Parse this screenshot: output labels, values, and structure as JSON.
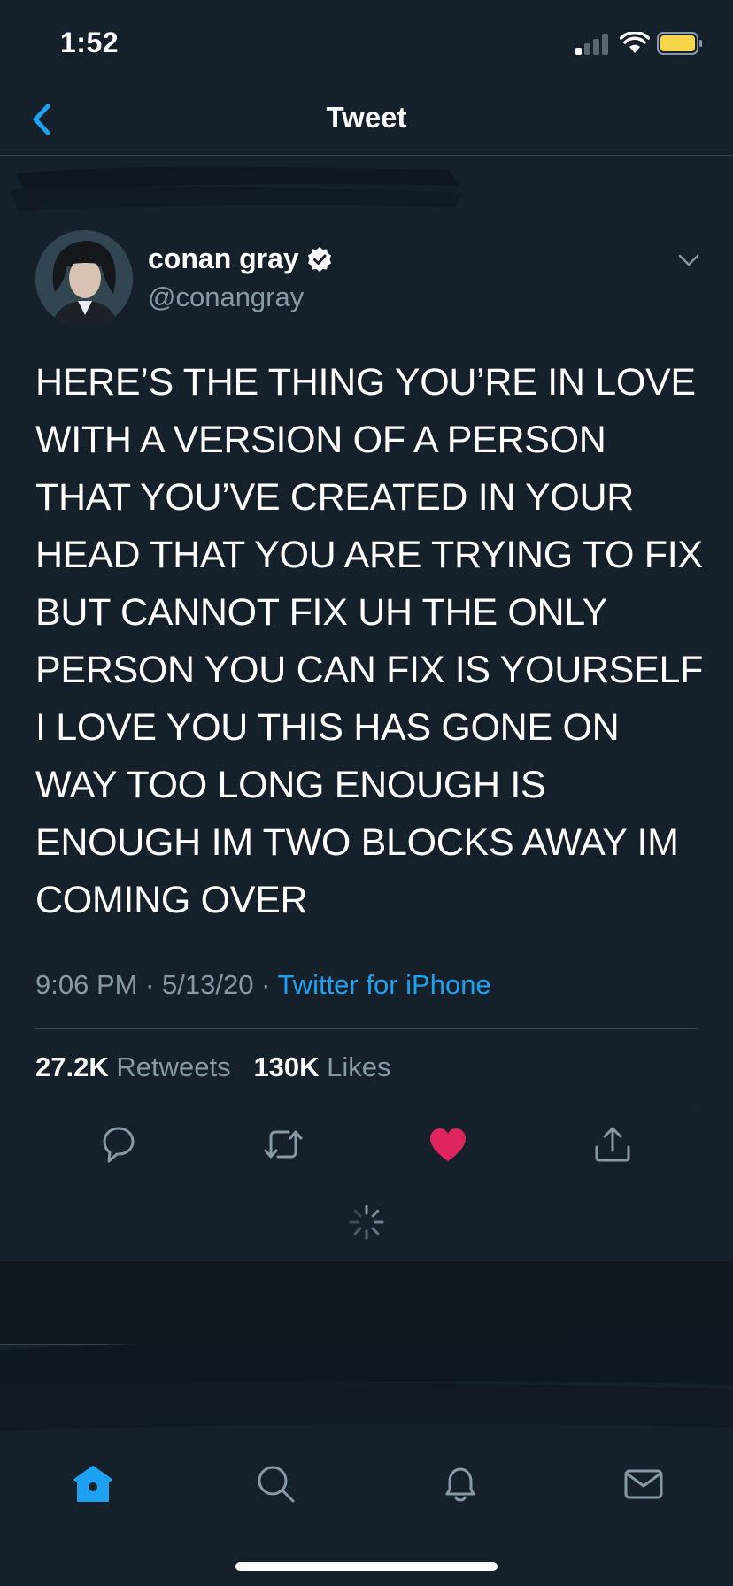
{
  "status_bar": {
    "time": "1:52"
  },
  "nav": {
    "title": "Tweet"
  },
  "tweet": {
    "author_name": "conan gray",
    "author_handle": "@conangray",
    "text": "HERE’S THE THING YOU’RE IN LOVE WITH A VERSION OF A PERSON THAT YOU’VE CREATED IN YOUR HEAD THAT YOU ARE TRYING TO FIX BUT CANNOT FIX UH THE ONLY PERSON YOU CAN FIX IS YOURSELF I LOVE YOU THIS HAS GONE ON WAY TOO LONG ENOUGH IS ENOUGH IM TWO BLOCKS AWAY IM COMING OVER",
    "time": "9:06 PM",
    "date": "5/13/20",
    "separator": " · ",
    "source": "Twitter for iPhone",
    "retweets_count": "27.2K",
    "retweets_label": "Retweets",
    "likes_count": "130K",
    "likes_label": "Likes",
    "liked": true
  },
  "actions": [
    "reply-icon",
    "retweet-icon",
    "like-icon",
    "share-icon"
  ],
  "tab_bar": [
    "home-icon",
    "search-icon",
    "notifications-icon",
    "messages-icon"
  ],
  "colors": {
    "background": "#15202b",
    "accent": "#1da1f2",
    "like": "#e0245e",
    "muted": "#8899a6",
    "divider": "#38444d"
  }
}
